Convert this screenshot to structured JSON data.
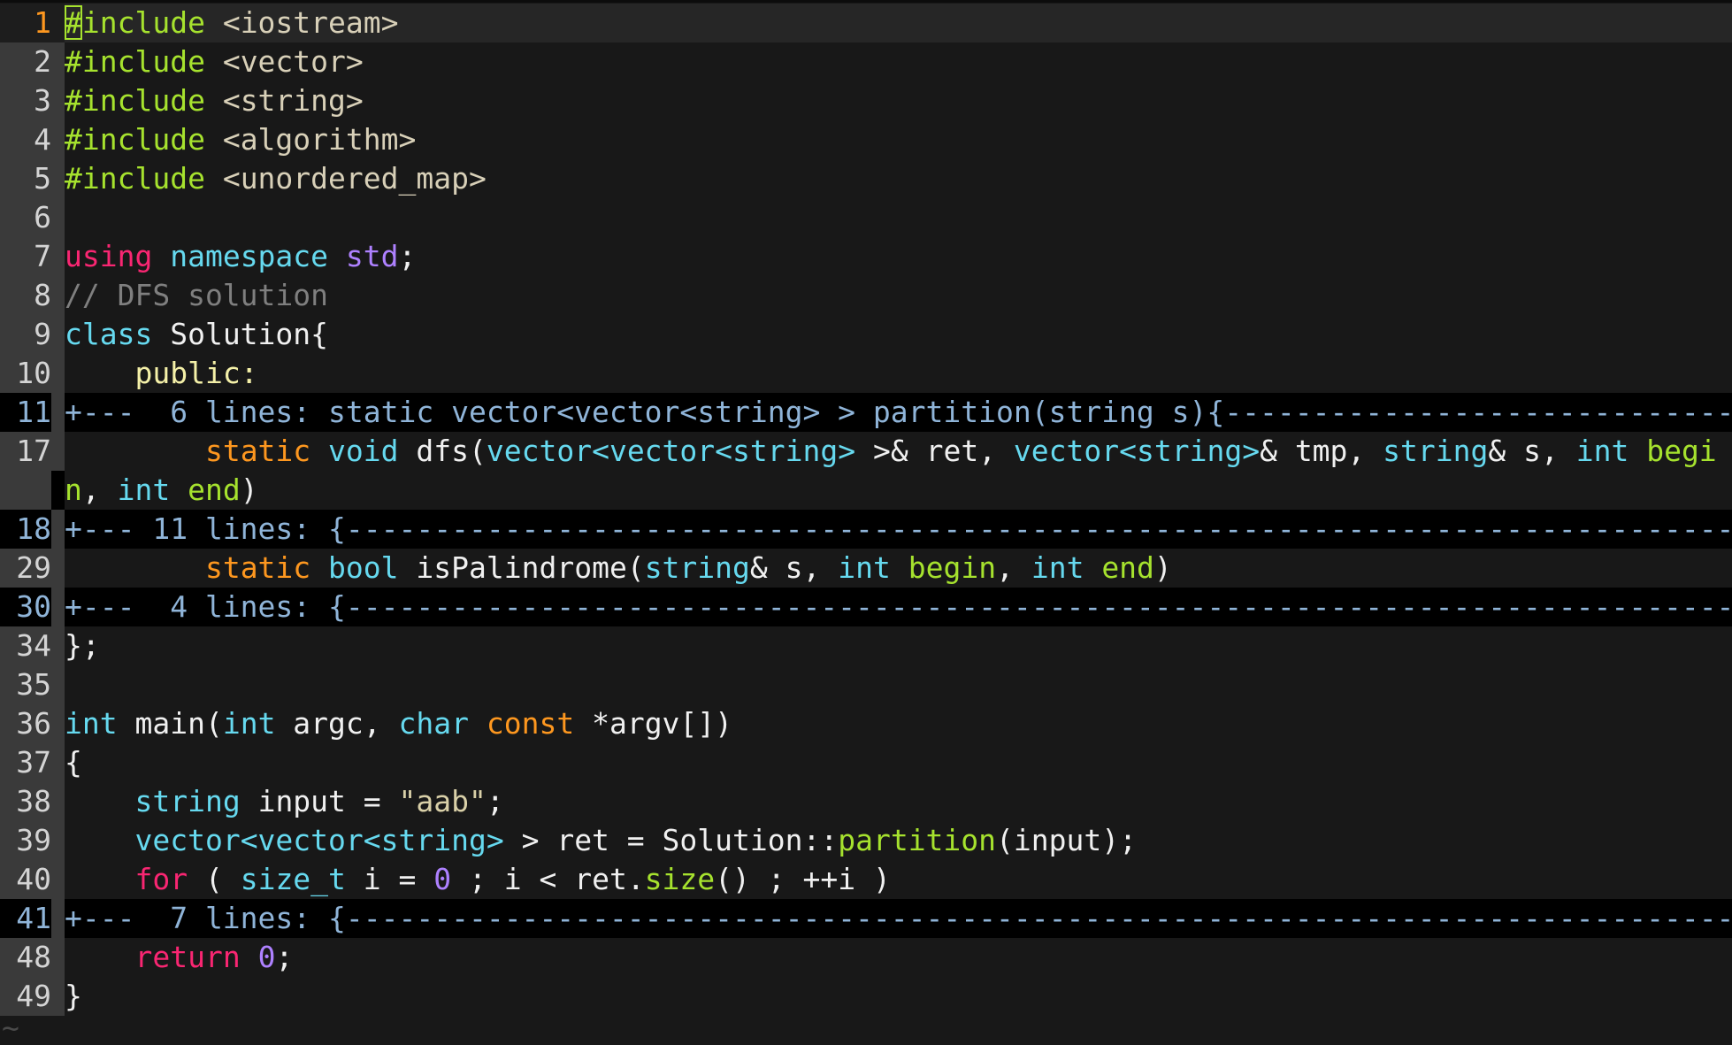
{
  "editor": {
    "current_line": 1,
    "tilde_marker": "~",
    "colors": {
      "background": "#181818",
      "gutter": "#3a3a3a",
      "current_line_number": "#fd971f",
      "fold_line": "#000000",
      "fold_text": "#8fb4d8",
      "preprocessor": "#a6e22e",
      "keyword": "#f92672",
      "type": "#66d9ef",
      "storage": "#fd971f",
      "number": "#ae81ff",
      "comment": "#7f7f7f"
    },
    "lines": [
      {
        "num": "1",
        "kind": "current",
        "tokens": [
          {
            "t": "#",
            "c": "pre cursor"
          },
          {
            "t": "include",
            "c": "pre"
          },
          {
            "t": " <iostream>",
            "c": "inc"
          }
        ]
      },
      {
        "num": "2",
        "kind": "normal",
        "tokens": [
          {
            "t": "#include",
            "c": "pre"
          },
          {
            "t": " <vector>",
            "c": "inc"
          }
        ]
      },
      {
        "num": "3",
        "kind": "normal",
        "tokens": [
          {
            "t": "#include",
            "c": "pre"
          },
          {
            "t": " <string>",
            "c": "inc"
          }
        ]
      },
      {
        "num": "4",
        "kind": "normal",
        "tokens": [
          {
            "t": "#include",
            "c": "pre"
          },
          {
            "t": " <algorithm>",
            "c": "inc"
          }
        ]
      },
      {
        "num": "5",
        "kind": "normal",
        "tokens": [
          {
            "t": "#include",
            "c": "pre"
          },
          {
            "t": " <unordered_map>",
            "c": "inc"
          }
        ]
      },
      {
        "num": "6",
        "kind": "normal",
        "tokens": []
      },
      {
        "num": "7",
        "kind": "normal",
        "tokens": [
          {
            "t": "using",
            "c": "kw"
          },
          {
            "t": " ",
            "c": "id"
          },
          {
            "t": "namespace",
            "c": "ty"
          },
          {
            "t": " ",
            "c": "id"
          },
          {
            "t": "std",
            "c": "lib"
          },
          {
            "t": ";",
            "c": "id"
          }
        ]
      },
      {
        "num": "8",
        "kind": "normal",
        "tokens": [
          {
            "t": "// DFS solution",
            "c": "com"
          }
        ]
      },
      {
        "num": "9",
        "kind": "normal",
        "tokens": [
          {
            "t": "class",
            "c": "ty"
          },
          {
            "t": " Solution{",
            "c": "id"
          }
        ]
      },
      {
        "num": "10",
        "kind": "normal",
        "tokens": [
          {
            "t": "    ",
            "c": "id"
          },
          {
            "t": "public:",
            "c": "acc"
          }
        ]
      },
      {
        "num": "11",
        "kind": "fold",
        "tokens": [
          {
            "t": "+---  6 lines: static vector<vector<string> > partition(string s){------------------------------------",
            "c": "fold"
          }
        ]
      },
      {
        "num": "17",
        "kind": "normal",
        "tokens": [
          {
            "t": "        ",
            "c": "id"
          },
          {
            "t": "static",
            "c": "st"
          },
          {
            "t": " ",
            "c": "id"
          },
          {
            "t": "void",
            "c": "ty"
          },
          {
            "t": " dfs(",
            "c": "id"
          },
          {
            "t": "vector<vector<string>",
            "c": "ty"
          },
          {
            "t": " >& ret, ",
            "c": "id"
          },
          {
            "t": "vector<string>",
            "c": "ty"
          },
          {
            "t": "& tmp, ",
            "c": "id"
          },
          {
            "t": "string",
            "c": "ty"
          },
          {
            "t": "& s, ",
            "c": "id"
          },
          {
            "t": "int",
            "c": "ty"
          },
          {
            "t": " ",
            "c": "id"
          },
          {
            "t": "begi",
            "c": "fn"
          }
        ]
      },
      {
        "num": "",
        "kind": "cont",
        "tokens": [
          {
            "t": "n",
            "c": "fn"
          },
          {
            "t": ", ",
            "c": "id"
          },
          {
            "t": "int",
            "c": "ty"
          },
          {
            "t": " ",
            "c": "id"
          },
          {
            "t": "end",
            "c": "fn"
          },
          {
            "t": ")",
            "c": "id"
          }
        ]
      },
      {
        "num": "18",
        "kind": "fold",
        "tokens": [
          {
            "t": "+--- 11 lines: {-------------------------------------------------------------------------------------------",
            "c": "fold"
          }
        ]
      },
      {
        "num": "29",
        "kind": "normal",
        "tokens": [
          {
            "t": "        ",
            "c": "id"
          },
          {
            "t": "static",
            "c": "st"
          },
          {
            "t": " ",
            "c": "id"
          },
          {
            "t": "bool",
            "c": "ty"
          },
          {
            "t": " isPalindrome(",
            "c": "id"
          },
          {
            "t": "string",
            "c": "ty"
          },
          {
            "t": "& s, ",
            "c": "id"
          },
          {
            "t": "int",
            "c": "ty"
          },
          {
            "t": " ",
            "c": "id"
          },
          {
            "t": "begin",
            "c": "fn"
          },
          {
            "t": ", ",
            "c": "id"
          },
          {
            "t": "int",
            "c": "ty"
          },
          {
            "t": " ",
            "c": "id"
          },
          {
            "t": "end",
            "c": "fn"
          },
          {
            "t": ")",
            "c": "id"
          }
        ]
      },
      {
        "num": "30",
        "kind": "fold",
        "tokens": [
          {
            "t": "+---  4 lines: {-------------------------------------------------------------------------------------------",
            "c": "fold"
          }
        ]
      },
      {
        "num": "34",
        "kind": "normal",
        "tokens": [
          {
            "t": "};",
            "c": "id"
          }
        ]
      },
      {
        "num": "35",
        "kind": "normal",
        "tokens": []
      },
      {
        "num": "36",
        "kind": "normal",
        "tokens": [
          {
            "t": "int",
            "c": "ty"
          },
          {
            "t": " main(",
            "c": "id"
          },
          {
            "t": "int",
            "c": "ty"
          },
          {
            "t": " argc, ",
            "c": "id"
          },
          {
            "t": "char",
            "c": "ty"
          },
          {
            "t": " ",
            "c": "id"
          },
          {
            "t": "const",
            "c": "st"
          },
          {
            "t": " *argv[])",
            "c": "id"
          }
        ]
      },
      {
        "num": "37",
        "kind": "normal",
        "tokens": [
          {
            "t": "{",
            "c": "id"
          }
        ]
      },
      {
        "num": "38",
        "kind": "normal",
        "tokens": [
          {
            "t": "    ",
            "c": "id"
          },
          {
            "t": "string",
            "c": "ty"
          },
          {
            "t": " input = ",
            "c": "id"
          },
          {
            "t": "\"aab\"",
            "c": "str"
          },
          {
            "t": ";",
            "c": "id"
          }
        ]
      },
      {
        "num": "39",
        "kind": "normal",
        "tokens": [
          {
            "t": "    ",
            "c": "id"
          },
          {
            "t": "vector<vector<string>",
            "c": "ty"
          },
          {
            "t": " > ret = Solution::",
            "c": "id"
          },
          {
            "t": "partition",
            "c": "fn"
          },
          {
            "t": "(input);",
            "c": "id"
          }
        ]
      },
      {
        "num": "40",
        "kind": "normal",
        "tokens": [
          {
            "t": "    ",
            "c": "id"
          },
          {
            "t": "for",
            "c": "kw"
          },
          {
            "t": " ( ",
            "c": "id"
          },
          {
            "t": "size_t",
            "c": "ty"
          },
          {
            "t": " i = ",
            "c": "id"
          },
          {
            "t": "0",
            "c": "num"
          },
          {
            "t": " ; i < ret.",
            "c": "id"
          },
          {
            "t": "size",
            "c": "fn"
          },
          {
            "t": "() ; ++i )",
            "c": "id"
          }
        ]
      },
      {
        "num": "41",
        "kind": "fold",
        "tokens": [
          {
            "t": "+---  7 lines: {-------------------------------------------------------------------------------------------",
            "c": "fold"
          }
        ]
      },
      {
        "num": "48",
        "kind": "normal",
        "tokens": [
          {
            "t": "    ",
            "c": "id"
          },
          {
            "t": "return",
            "c": "kw"
          },
          {
            "t": " ",
            "c": "id"
          },
          {
            "t": "0",
            "c": "num"
          },
          {
            "t": ";",
            "c": "id"
          }
        ]
      },
      {
        "num": "49",
        "kind": "normal",
        "tokens": [
          {
            "t": "}",
            "c": "id"
          }
        ]
      }
    ]
  }
}
